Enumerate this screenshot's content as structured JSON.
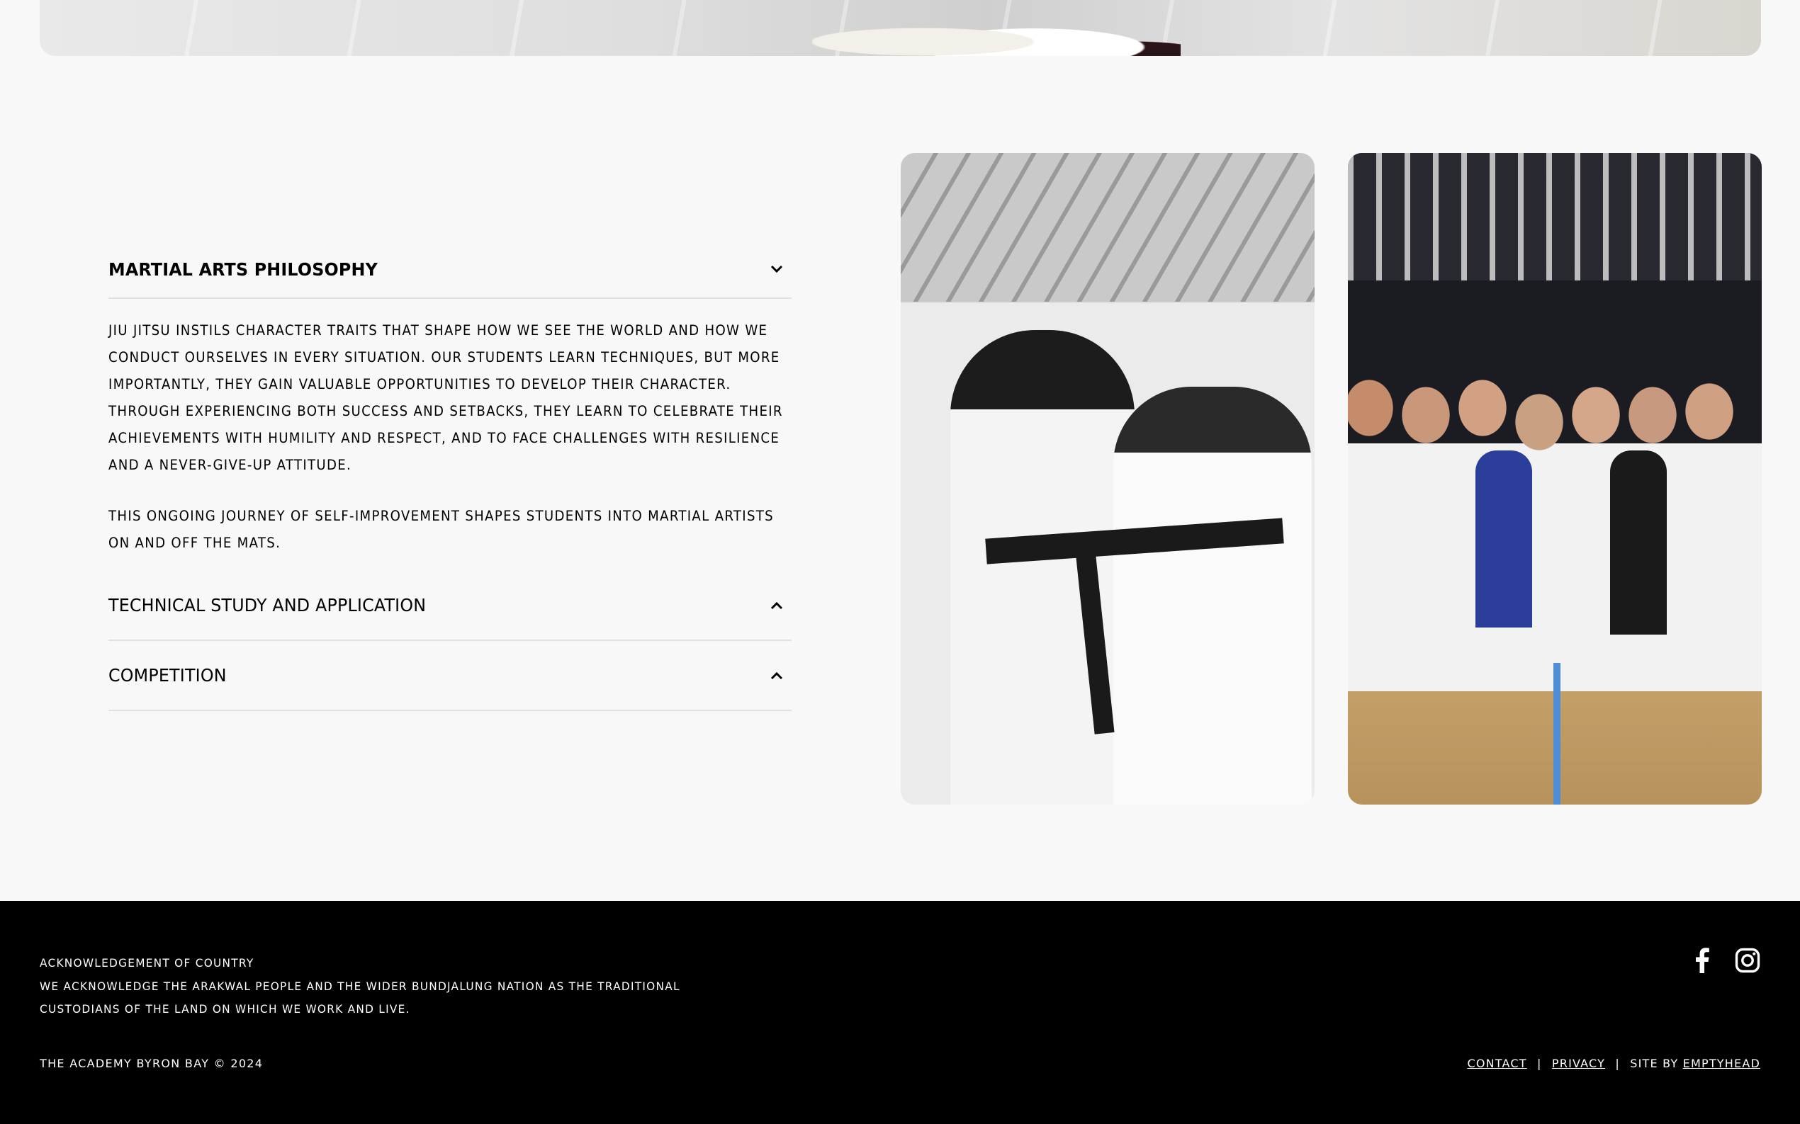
{
  "accordion": {
    "items": [
      {
        "title": "MARTIAL ARTS PHILOSOPHY",
        "state": "expanded",
        "paragraphs": [
          "JIU JITSU INSTILS CHARACTER TRAITS THAT SHAPE HOW WE SEE THE WORLD AND HOW WE CONDUCT OURSELVES IN EVERY SITUATION. OUR STUDENTS LEARN TECHNIQUES, BUT MORE IMPORTANTLY, THEY GAIN VALUABLE OPPORTUNITIES TO DEVELOP THEIR CHARACTER. THROUGH EXPERIENCING BOTH SUCCESS AND SETBACKS, THEY LEARN TO CELEBRATE THEIR ACHIEVEMENTS WITH HUMILITY AND RESPECT, AND TO FACE CHALLENGES WITH RESILIENCE AND A NEVER-GIVE-UP ATTITUDE.",
          "THIS ONGOING JOURNEY OF SELF-IMPROVEMENT SHAPES STUDENTS INTO MARTIAL ARTISTS ON AND OFF THE MATS."
        ],
        "icon": "chevron-down-icon"
      },
      {
        "title": "TECHNICAL STUDY AND APPLICATION",
        "state": "collapsed",
        "icon": "chevron-up-icon"
      },
      {
        "title": "COMPETITION",
        "state": "collapsed",
        "icon": "chevron-up-icon"
      }
    ]
  },
  "images": [
    {
      "name": "belt-promotion-photo"
    },
    {
      "name": "kids-competition-team-photo"
    }
  ],
  "footer": {
    "ack_title": "ACKNOWLEDGEMENT OF COUNTRY",
    "ack_line1": "WE ACKNOWLEDGE THE ARAKWAL PEOPLE AND THE WIDER BUNDJALUNG NATION AS THE TRADITIONAL",
    "ack_line2": "CUSTODIANS OF THE LAND ON WHICH WE WORK AND LIVE.",
    "copyright": "THE ACADEMY BYRON BAY © 2024",
    "links": {
      "contact": "CONTACT",
      "privacy": "PRIVACY",
      "site_by": "SITE BY",
      "emptyhead": "EMPTYHEAD",
      "separator": "|"
    },
    "social": [
      "facebook-icon",
      "instagram-icon"
    ]
  },
  "colors": {
    "page_bg": "#f8f8f8",
    "footer_bg": "#000000",
    "divider": "#e1e1e1"
  }
}
